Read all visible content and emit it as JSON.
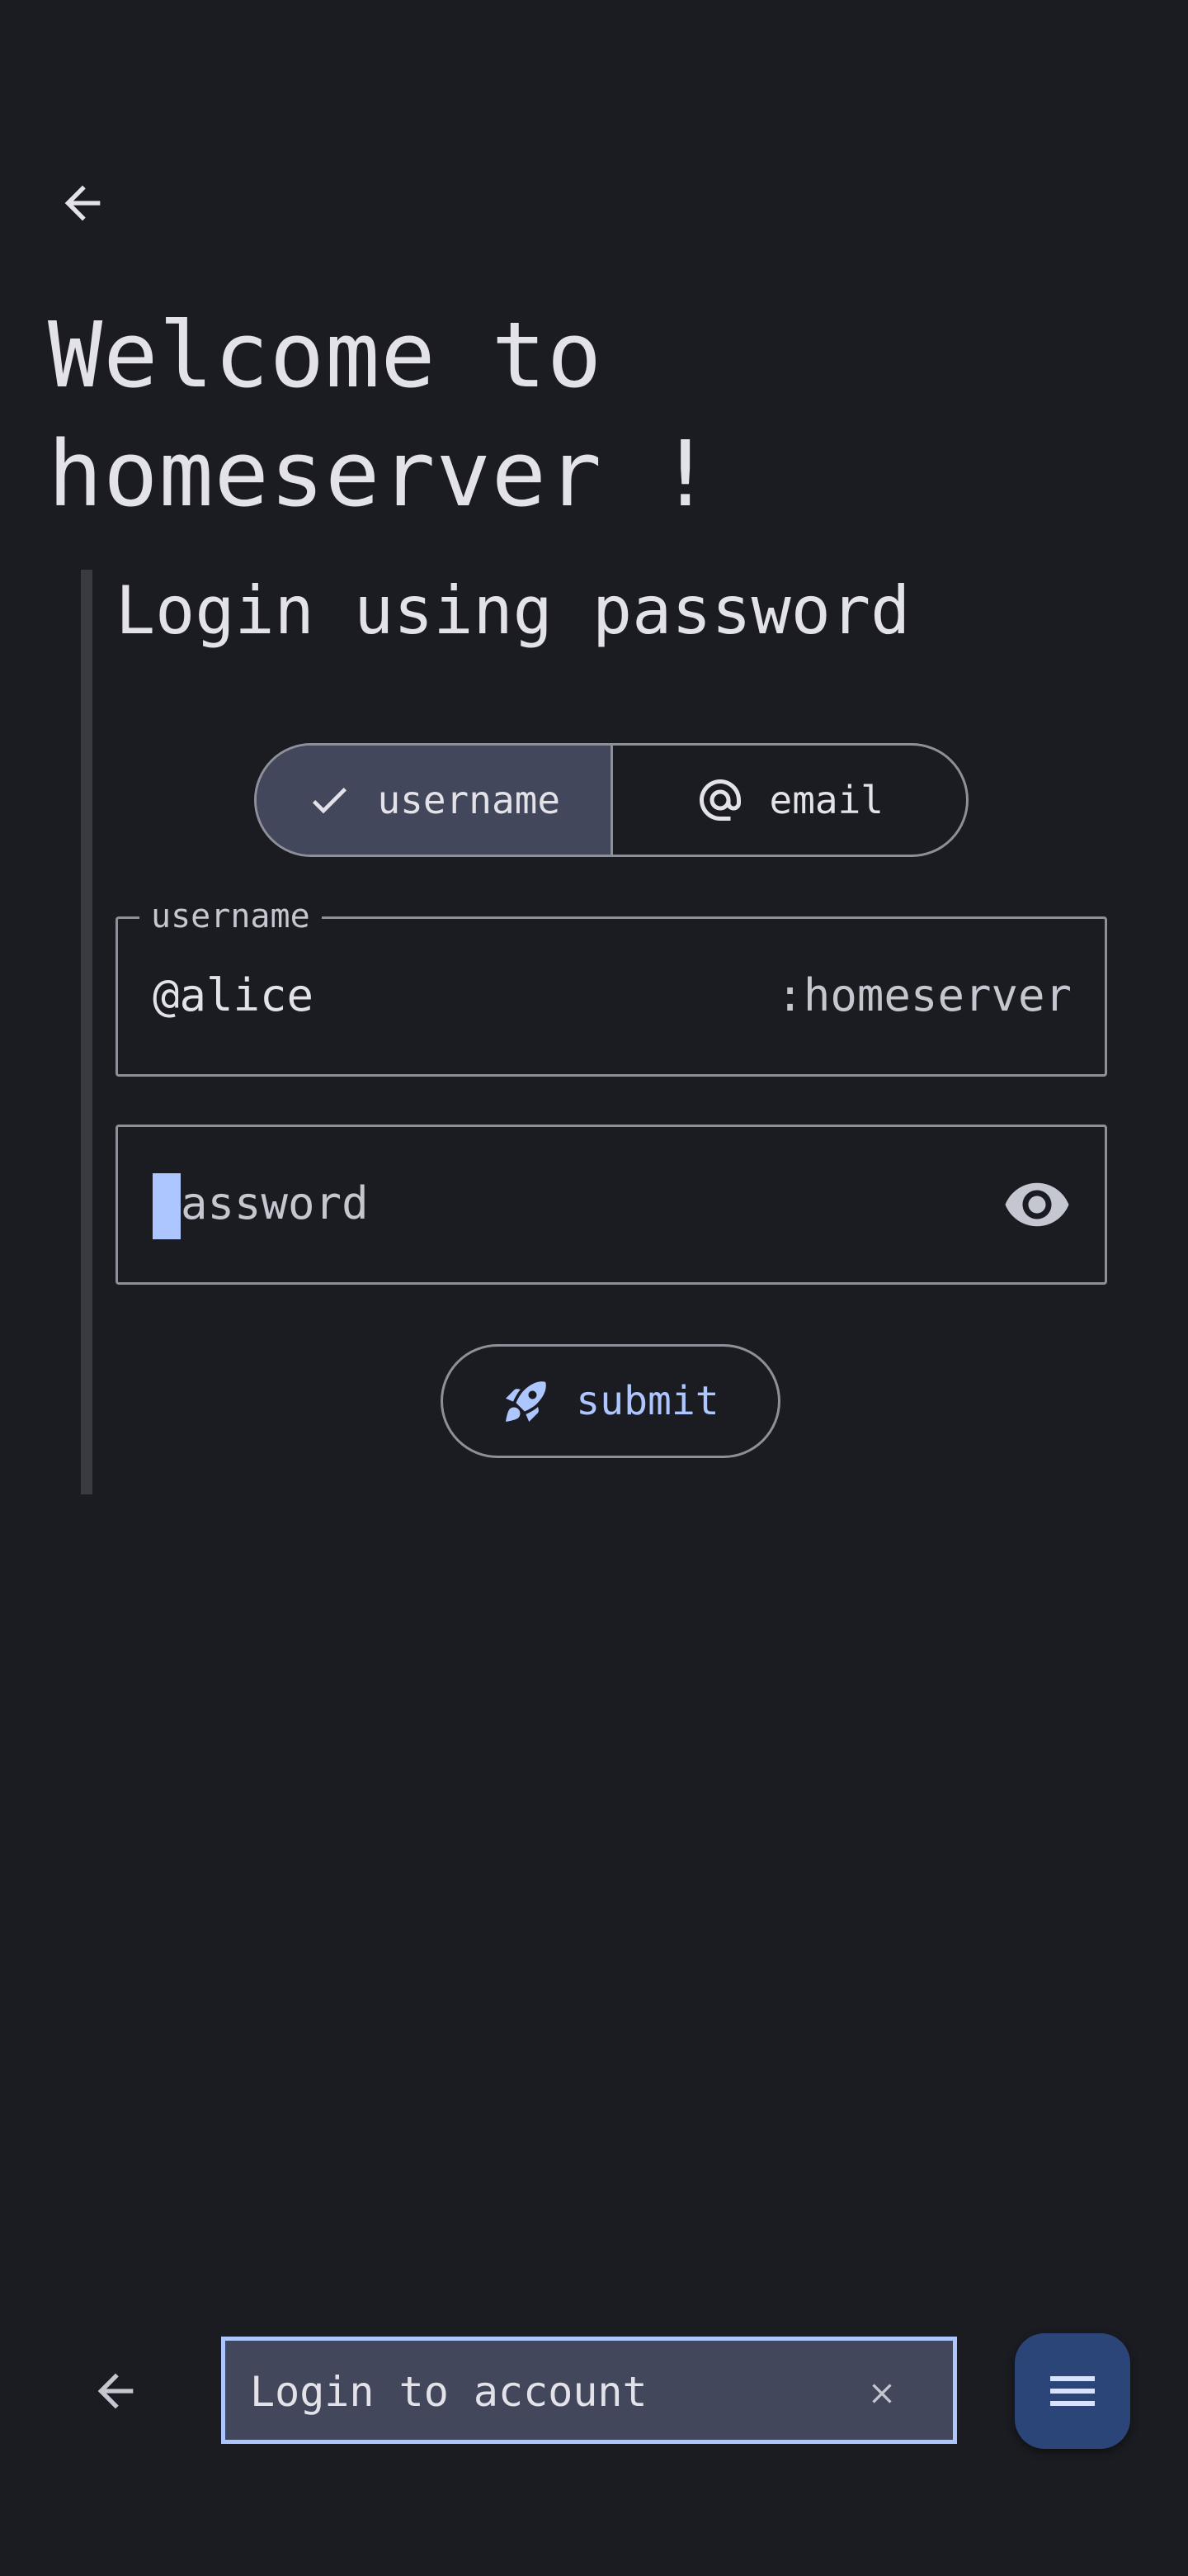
{
  "header": {
    "back_icon": "arrow-back-icon",
    "title": "Welcome to homeserver !"
  },
  "login": {
    "subtitle": "Login using password",
    "mode_toggle": {
      "username": {
        "label": "username",
        "icon": "check-icon",
        "selected": true
      },
      "email": {
        "label": "email",
        "icon": "at-sign-icon",
        "selected": false
      }
    },
    "username_field": {
      "label": "username",
      "value": "@alice",
      "suffix": ":homeserver"
    },
    "password_field": {
      "placeholder": "assword",
      "visibility_icon": "eye-icon"
    },
    "submit": {
      "label": "submit",
      "icon": "rocket-icon"
    }
  },
  "bottom_bar": {
    "back_icon": "arrow-back-icon",
    "location_text": "Login to account",
    "clear_icon": "close-icon",
    "menu_icon": "menu-icon"
  },
  "colors": {
    "background": "#1b1c21",
    "surface_variant": "#42475c",
    "outline": "#8e9099",
    "accent": "#aec6ff",
    "fab": "#2c4578",
    "on_surface": "#e3e2e9"
  }
}
